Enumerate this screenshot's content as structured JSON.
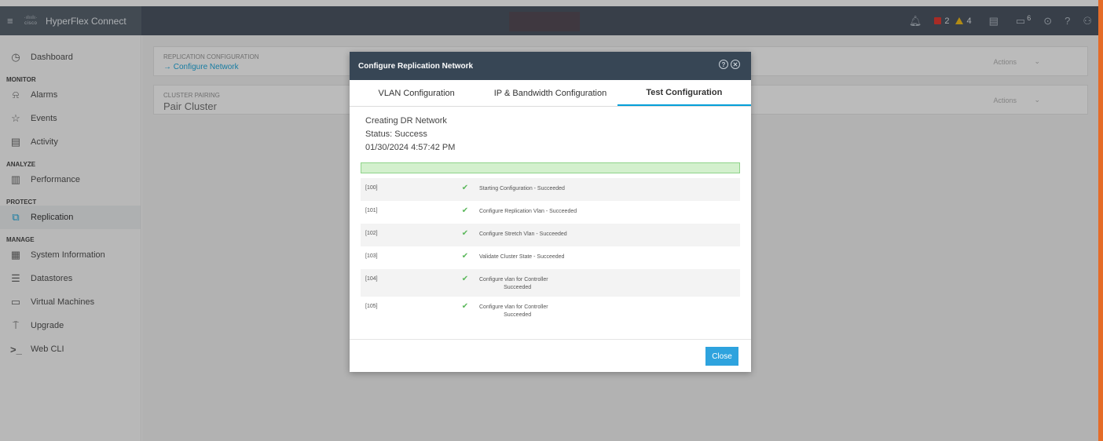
{
  "app": {
    "title": "HyperFlex Connect",
    "logo_text": "cisco"
  },
  "topbar": {
    "alarm_red_count": "2",
    "alarm_amber_count": "4",
    "messages_count": "6"
  },
  "sidebar": {
    "dashboard": "Dashboard",
    "sections": {
      "monitor": "MONITOR",
      "analyze": "ANALYZE",
      "protect": "PROTECT",
      "manage": "MANAGE"
    },
    "items": {
      "alarms": "Alarms",
      "events": "Events",
      "activity": "Activity",
      "performance": "Performance",
      "replication": "Replication",
      "system_information": "System Information",
      "datastores": "Datastores",
      "virtual_machines": "Virtual Machines",
      "upgrade": "Upgrade",
      "web_cli": "Web CLI"
    }
  },
  "main": {
    "panels": [
      {
        "label": "REPLICATION CONFIGURATION",
        "value": "→ Configure Network",
        "action": "Actions"
      },
      {
        "label": "CLUSTER PAIRING",
        "value": "Pair Cluster",
        "action": "Actions"
      }
    ]
  },
  "modal": {
    "title": "Configure Replication Network",
    "tabs": [
      "VLAN Configuration",
      "IP & Bandwidth Configuration",
      "Test Configuration"
    ],
    "active_tab": 2,
    "status_lines": [
      "Creating DR Network",
      "Status: Success",
      "01/30/2024 4:57:42 PM"
    ],
    "progress": 1.0,
    "log": [
      {
        "code": "[100]",
        "message": "Starting Configuration - Succeeded"
      },
      {
        "code": "[101]",
        "message": "Configure Replication Vlan - Succeeded"
      },
      {
        "code": "[102]",
        "message": "Configure Stretch Vlan - Succeeded"
      },
      {
        "code": "[103]",
        "message": "Validate Cluster State - Succeeded"
      },
      {
        "code": "[104]",
        "message": "Configure vlan for Controller\n                Succeeded"
      },
      {
        "code": "[105]",
        "message": "Configure vlan for Controller\n                Succeeded"
      }
    ],
    "close_label": "Close"
  },
  "colors": {
    "accent": "#049fd9",
    "header": "#374655",
    "success": "#5cb85c",
    "alert_red": "#e2231a",
    "alert_amber": "#f2b600"
  }
}
